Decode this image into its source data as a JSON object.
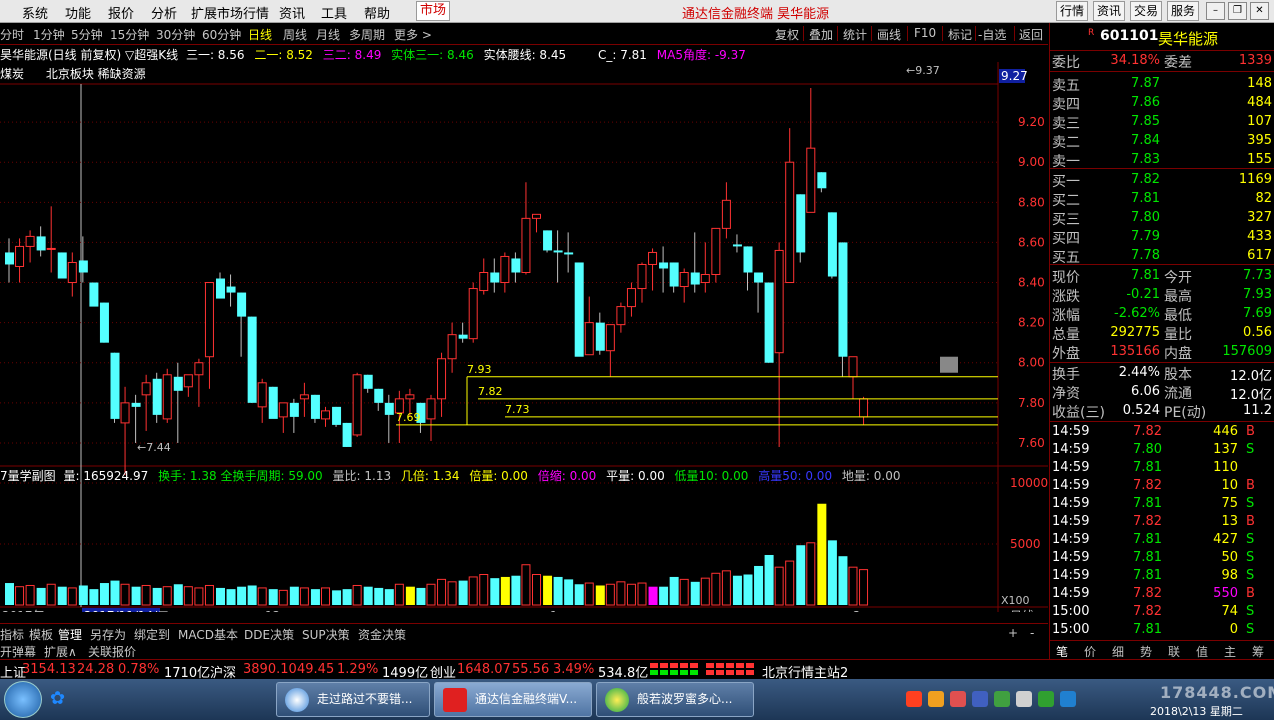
{
  "menu": {
    "items": [
      "系统",
      "功能",
      "报价",
      "分析",
      "扩展市场行情",
      "资讯",
      "工具",
      "帮助"
    ],
    "market_btn": "市场",
    "app_title": "通达信金融终端  昊华能源",
    "right_buttons": [
      "行情",
      "资讯",
      "交易",
      "服务"
    ]
  },
  "periods": {
    "items": [
      "分时",
      "1分钟",
      "5分钟",
      "15分钟",
      "30分钟",
      "60分钟",
      "日线",
      "周线",
      "月线",
      "多周期",
      "更多 >"
    ],
    "active": "日线"
  },
  "toolbar": {
    "items": [
      "复权",
      "叠加",
      "统计",
      "画线",
      "F10",
      "标记",
      "-自选",
      "返回"
    ],
    "diamond": "◇ ◇"
  },
  "indicator_line": {
    "name": "昊华能源(日线 前复权)",
    "ind": "▽超强K线",
    "s1": "三一: 8.56",
    "s2": "二一: 8.52",
    "s3": "三二: 8.49",
    "s4": "实体三一: 8.46",
    "s5": "实体腰线: 8.45",
    "s6": "C_: 7.81",
    "s7": "MA5角度: -9.37"
  },
  "sub_line": {
    "industry": "煤炭",
    "concepts": "北京板块  稀缺资源"
  },
  "chart_data": {
    "type": "candlestick",
    "y_axis_ticks": [
      "9.20",
      "9.00",
      "8.80",
      "8.60",
      "8.40",
      "8.20",
      "8.00",
      "7.80",
      "7.60"
    ],
    "current_price_tag": "9.27",
    "annotations": {
      "high": "9.37",
      "low": "7.44",
      "lines": [
        "7.93",
        "7.82",
        "7.73",
        "7.69"
      ]
    },
    "x_labels": [
      "2017年",
      "2017/11/14/二",
      "12",
      "1",
      "2"
    ],
    "candles": [
      [
        8.55,
        8.62,
        8.4,
        8.49
      ],
      [
        8.48,
        8.62,
        8.4,
        8.58
      ],
      [
        8.58,
        8.66,
        8.5,
        8.63
      ],
      [
        8.63,
        8.68,
        8.53,
        8.56
      ],
      [
        8.57,
        8.78,
        8.45,
        8.57
      ],
      [
        8.55,
        8.55,
        8.43,
        8.42
      ],
      [
        8.4,
        8.55,
        8.33,
        8.5
      ],
      [
        8.51,
        8.63,
        8.4,
        8.45
      ],
      [
        8.4,
        8.4,
        8.33,
        8.28
      ],
      [
        8.3,
        8.3,
        8.1,
        8.1
      ],
      [
        8.05,
        8.05,
        7.7,
        7.72
      ],
      [
        7.7,
        7.88,
        7.44,
        7.8
      ],
      [
        7.8,
        7.84,
        7.6,
        7.78
      ],
      [
        7.84,
        7.94,
        7.66,
        7.9
      ],
      [
        7.92,
        7.95,
        7.7,
        7.74
      ],
      [
        7.72,
        7.97,
        7.7,
        7.94
      ],
      [
        7.93,
        8.0,
        7.6,
        7.86
      ],
      [
        7.88,
        7.88,
        7.83,
        7.94
      ],
      [
        7.94,
        8.02,
        7.78,
        8.0
      ],
      [
        8.03,
        8.4,
        7.87,
        8.4
      ],
      [
        8.42,
        8.45,
        8.33,
        8.32
      ],
      [
        8.38,
        8.44,
        8.28,
        8.35
      ],
      [
        8.35,
        8.35,
        8.03,
        8.23
      ],
      [
        8.23,
        8.23,
        7.8,
        7.8
      ],
      [
        7.78,
        7.92,
        7.7,
        7.9
      ],
      [
        7.88,
        7.88,
        7.73,
        7.72
      ],
      [
        7.73,
        7.8,
        7.65,
        7.8
      ],
      [
        7.8,
        7.82,
        7.65,
        7.73
      ],
      [
        7.82,
        7.9,
        7.73,
        7.84
      ],
      [
        7.84,
        7.84,
        7.7,
        7.72
      ],
      [
        7.72,
        7.78,
        7.68,
        7.76
      ],
      [
        7.78,
        7.78,
        7.68,
        7.69
      ],
      [
        7.7,
        7.7,
        7.58,
        7.58
      ],
      [
        7.64,
        7.95,
        7.63,
        7.94
      ],
      [
        7.94,
        7.94,
        7.85,
        7.87
      ],
      [
        7.87,
        7.87,
        7.76,
        7.8
      ],
      [
        7.8,
        7.84,
        7.6,
        7.74
      ],
      [
        7.75,
        7.86,
        7.6,
        7.82
      ],
      [
        7.82,
        7.87,
        7.73,
        7.84
      ],
      [
        7.8,
        7.8,
        7.65,
        7.7
      ],
      [
        7.72,
        7.84,
        7.61,
        7.82
      ],
      [
        7.82,
        8.05,
        7.73,
        8.02
      ],
      [
        8.02,
        8.2,
        7.95,
        8.14
      ],
      [
        8.14,
        8.2,
        8.1,
        8.12
      ],
      [
        8.12,
        8.4,
        8.1,
        8.37
      ],
      [
        8.36,
        8.52,
        8.34,
        8.45
      ],
      [
        8.45,
        8.52,
        8.35,
        8.4
      ],
      [
        8.4,
        8.55,
        8.35,
        8.53
      ],
      [
        8.52,
        8.55,
        8.4,
        8.45
      ],
      [
        8.45,
        8.9,
        8.44,
        8.72
      ],
      [
        8.72,
        8.74,
        8.65,
        8.74
      ],
      [
        8.66,
        8.66,
        8.55,
        8.56
      ],
      [
        8.56,
        8.66,
        8.4,
        8.55
      ],
      [
        8.55,
        8.65,
        8.45,
        8.54
      ],
      [
        8.5,
        8.5,
        8.1,
        8.03
      ],
      [
        8.04,
        8.33,
        8.04,
        8.2
      ],
      [
        8.2,
        8.25,
        8.04,
        8.06
      ],
      [
        8.06,
        8.1,
        7.93,
        8.19
      ],
      [
        8.19,
        8.3,
        8.15,
        8.28
      ],
      [
        8.28,
        8.4,
        8.23,
        8.37
      ],
      [
        8.37,
        8.5,
        8.3,
        8.49
      ],
      [
        8.49,
        8.57,
        8.36,
        8.55
      ],
      [
        8.5,
        8.58,
        8.35,
        8.47
      ],
      [
        8.5,
        8.5,
        8.35,
        8.38
      ],
      [
        8.38,
        8.47,
        8.3,
        8.45
      ],
      [
        8.45,
        8.65,
        8.35,
        8.39
      ],
      [
        8.4,
        8.6,
        8.35,
        8.44
      ],
      [
        8.44,
        8.66,
        8.4,
        8.67
      ],
      [
        8.67,
        8.9,
        8.62,
        8.81
      ],
      [
        8.59,
        8.64,
        8.55,
        8.58
      ],
      [
        8.58,
        8.58,
        8.36,
        8.45
      ],
      [
        8.45,
        8.45,
        8.25,
        8.4
      ],
      [
        8.4,
        8.4,
        8.0,
        8.0
      ],
      [
        8.05,
        8.6,
        7.58,
        8.56
      ],
      [
        8.4,
        9.17,
        8.4,
        9.0
      ],
      [
        8.84,
        8.84,
        8.5,
        8.55
      ],
      [
        8.75,
        9.37,
        8.75,
        9.07
      ],
      [
        8.95,
        8.95,
        8.85,
        8.87
      ],
      [
        8.75,
        8.75,
        8.42,
        8.43
      ],
      [
        8.6,
        8.6,
        7.93,
        8.03
      ],
      [
        7.93,
        7.93,
        7.82,
        8.03
      ],
      [
        7.73,
        7.83,
        7.69,
        7.82
      ]
    ],
    "volume_ticks": [
      "10000",
      "5000"
    ],
    "volume_unit": "X100",
    "volume_note": "量: 165924.97"
  },
  "vol_info": {
    "name": "7量学副图",
    "v1": "量: 165924.97",
    "v2": "换手: 1.38",
    "v3": "全换手周期: 59.00",
    "v4": "量比: 1.13",
    "v5": "几倍: 1.34",
    "v6": "倍量: 0.00",
    "v7": "倍缩: 0.00",
    "v8": "平量: 0.00",
    "v9": "低量10: 0.00",
    "v10": "高量50: 0.00",
    "v11": "地量: 0.00"
  },
  "bottom_tabs": {
    "items": [
      "指标",
      "模板",
      "管理",
      "另存为",
      "绑定到",
      "MACD基本",
      "DDE决策",
      "SUP决策",
      "资金决策"
    ],
    "active": "管理",
    "period_label": "日线",
    "plus": "+",
    "minus": "-"
  },
  "bottom2": {
    "items": [
      "开弹幕",
      "扩展∧",
      "关联报价"
    ]
  },
  "stock": {
    "code": "601101",
    "name": "昊华能源",
    "badge": "R",
    "wei_bi_label": "委比",
    "wei_bi": "34.18%",
    "wei_cha_label": "委差",
    "wei_cha": "1339",
    "asks": [
      {
        "label": "卖五",
        "price": "7.87",
        "vol": "148"
      },
      {
        "label": "卖四",
        "price": "7.86",
        "vol": "484"
      },
      {
        "label": "卖三",
        "price": "7.85",
        "vol": "107"
      },
      {
        "label": "卖二",
        "price": "7.84",
        "vol": "395"
      },
      {
        "label": "卖一",
        "price": "7.83",
        "vol": "155"
      }
    ],
    "bids": [
      {
        "label": "买一",
        "price": "7.82",
        "vol": "1169"
      },
      {
        "label": "买二",
        "price": "7.81",
        "vol": "82"
      },
      {
        "label": "买三",
        "price": "7.80",
        "vol": "327"
      },
      {
        "label": "买四",
        "price": "7.79",
        "vol": "433"
      },
      {
        "label": "买五",
        "price": "7.78",
        "vol": "617"
      }
    ],
    "quote": [
      {
        "l1": "现价",
        "v1": "7.81",
        "c1": "grn",
        "l2": "今开",
        "v2": "7.73",
        "c2": "grn"
      },
      {
        "l1": "涨跌",
        "v1": "-0.21",
        "c1": "grn",
        "l2": "最高",
        "v2": "7.93",
        "c2": "grn"
      },
      {
        "l1": "涨幅",
        "v1": "-2.62%",
        "c1": "grn",
        "l2": "最低",
        "v2": "7.69",
        "c2": "grn"
      },
      {
        "l1": "总量",
        "v1": "292775",
        "c1": "yel",
        "l2": "量比",
        "v2": "0.56",
        "c2": "yel"
      },
      {
        "l1": "外盘",
        "v1": "135166",
        "c1": "red",
        "l2": "内盘",
        "v2": "157609",
        "c2": "grn"
      }
    ],
    "fund": [
      {
        "l1": "换手",
        "v1": "2.44%",
        "l2": "股本",
        "v2": "12.0亿"
      },
      {
        "l1": "净资",
        "v1": "6.06",
        "l2": "流通",
        "v2": "12.0亿"
      },
      {
        "l1": "收益(三)",
        "v1": "0.524",
        "l2": "PE(动)",
        "v2": "11.2"
      }
    ]
  },
  "ticks": [
    {
      "t": "14:59",
      "p": "7.82",
      "v": "446",
      "f": "B"
    },
    {
      "t": "14:59",
      "p": "7.80",
      "v": "137",
      "f": "S"
    },
    {
      "t": "14:59",
      "p": "7.81",
      "v": "110",
      "f": ""
    },
    {
      "t": "14:59",
      "p": "7.82",
      "v": "10",
      "f": "B"
    },
    {
      "t": "14:59",
      "p": "7.81",
      "v": "75",
      "f": "S"
    },
    {
      "t": "14:59",
      "p": "7.82",
      "v": "13",
      "f": "B"
    },
    {
      "t": "14:59",
      "p": "7.81",
      "v": "427",
      "f": "S"
    },
    {
      "t": "14:59",
      "p": "7.81",
      "v": "50",
      "f": "S"
    },
    {
      "t": "14:59",
      "p": "7.81",
      "v": "98",
      "f": "S"
    },
    {
      "t": "14:59",
      "p": "7.82",
      "v": "550",
      "f": "B"
    },
    {
      "t": "15:00",
      "p": "7.82",
      "v": "74",
      "f": "S"
    },
    {
      "t": "15:00",
      "p": "7.81",
      "v": "0",
      "f": "S"
    }
  ],
  "right_tabs": [
    "笔",
    "价",
    "细",
    "势",
    "联",
    "值",
    "主",
    "筹"
  ],
  "status": {
    "sh_label": "上证",
    "sh_val": "3154.13",
    "sh_chg": "24.28",
    "sh_pct": "0.78%",
    "sh_amt": "1710亿",
    "hs_label": "沪深",
    "hs_val": "3890.10",
    "hs_chg": "49.45",
    "hs_pct": "1.29%",
    "hs_amt": "1499亿",
    "cy_label": "创业",
    "cy_val": "1648.07",
    "cy_chg": "55.56",
    "cy_pct": "3.49%",
    "cy_amt": "534.8亿",
    "station": "北京行情主站2"
  },
  "taskbar": {
    "tasks": [
      "走过路过不要错...",
      "通达信金融终端V...",
      "般若波罗蜜多心..."
    ],
    "clock": "2018\\2\\13 星期二",
    "watermark": "178448.COM"
  }
}
